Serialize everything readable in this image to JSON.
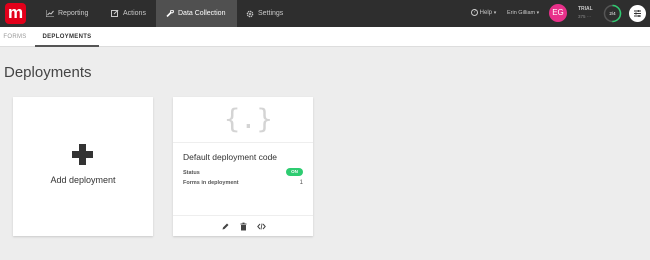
{
  "brand": {
    "logo_letter": "m",
    "accent": "#e2001a"
  },
  "nav": {
    "items": [
      {
        "label": "Reporting",
        "icon": "chart-icon"
      },
      {
        "label": "Actions",
        "icon": "edit-icon"
      },
      {
        "label": "Data Collection",
        "icon": "wrench-icon",
        "active": true
      },
      {
        "label": "Settings",
        "icon": "gear-icon"
      }
    ],
    "help": "Help",
    "user_name": "Erin Gilliam",
    "avatar_initials": "EG",
    "trial_label": "TRIAL",
    "trial_sub": "375 ···",
    "trial_ring_text": "2/4",
    "trial_progress": 0.5
  },
  "tabs": [
    {
      "label": "FORMS",
      "active": false
    },
    {
      "label": "DEPLOYMENTS",
      "active": true
    }
  ],
  "page": {
    "title": "Deployments"
  },
  "add_card": {
    "label": "Add deployment"
  },
  "deployment": {
    "icon_text": "{.}",
    "title": "Default deployment code",
    "status_label": "Status",
    "status_value": "ON",
    "forms_label": "Forms in deployment",
    "forms_count": "1",
    "actions": [
      "pencil-icon",
      "trash-icon",
      "code-icon"
    ],
    "status_color": "#2ecc71"
  }
}
